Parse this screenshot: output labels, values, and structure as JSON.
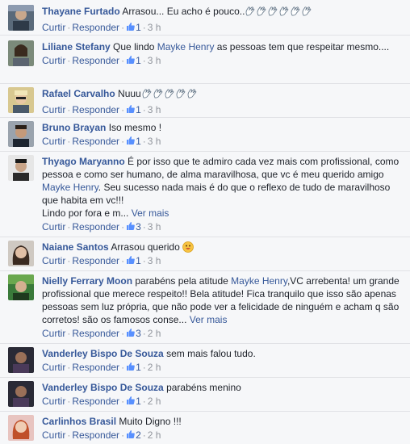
{
  "actions": {
    "reply": "Curtir",
    "respond": "Responder",
    "sep": "·"
  },
  "comments": [
    {
      "name": "Thayane Furtado",
      "text": "Arrasou... Eu acho é pouco..",
      "icon_row": "hands-emoji x6",
      "likes": "1",
      "time": "3 h"
    },
    {
      "name": "Liliane Stefany",
      "text_before": "Que lindo",
      "mention": "Mayke Henry",
      "text_after": "as pessoas tem que respeitar mesmo....",
      "likes": "1",
      "time": "3 h"
    },
    {
      "name": "Rafael Carvalho",
      "text": "Nuuu",
      "icon_row": "hands-emoji x5",
      "likes": "1",
      "time": "3 h"
    },
    {
      "name": "Bruno Brayan",
      "text": "Iso mesmo !",
      "likes": "1",
      "time": "3 h"
    },
    {
      "name": "Thyago Maryanno",
      "text_before": "É por isso que te admiro cada vez mais com profissional, como pessoa e como ser humano, de alma maravilhosa, que vc é meu querido amigo",
      "mention": "Mayke Henry",
      "text_after": ". Seu sucesso nada mais é do que o reflexo de tudo de maravilhoso que habita em vc!!!",
      "text_line2": "Lindo por fora e m...",
      "see_more": "Ver mais",
      "likes": "3",
      "time": "3 h"
    },
    {
      "name": "Naiane Santos",
      "text": "Arrasou querido",
      "icon_row": "smiley-emoji",
      "likes": "1",
      "time": "3 h"
    },
    {
      "name": "Nielly Ferrary Moon",
      "text_before": "parabéns pela atitude",
      "mention": "Mayke Henry",
      "text_after": ",VC arrebenta! um grande profissional que merece respeito!! Bela atitude! Fica tranquilo que isso são apenas pessoas sem luz própria, que não pode ver a felicidade de ninguém e acham q são corretos! são os famosos conse...",
      "see_more": "Ver mais",
      "likes": "3",
      "time": "2 h"
    },
    {
      "name": "Vanderley Bispo De Souza",
      "text": "sem mais falou tudo.",
      "likes": "1",
      "time": "2 h"
    },
    {
      "name": "Vanderley Bispo De Souza",
      "text": "parabéns menino",
      "likes": "1",
      "time": "2 h"
    },
    {
      "name": "Carlinhos Brasil",
      "text": "Muito Digno !!!",
      "likes": "2",
      "time": "2 h"
    }
  ]
}
